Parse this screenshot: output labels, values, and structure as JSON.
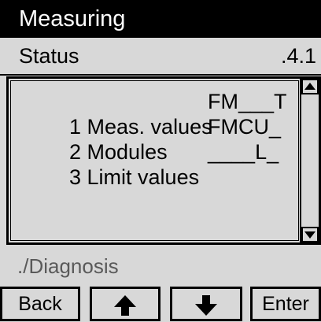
{
  "title": "Measuring",
  "status": {
    "label": "Status",
    "value": ".4.1"
  },
  "menu": {
    "items": [
      {
        "label": "1 Meas. values",
        "code": "FM___T"
      },
      {
        "label": "2 Modules",
        "code": "FMCU_"
      },
      {
        "label": "3 Limit values",
        "code": "____L_"
      }
    ]
  },
  "breadcrumb": "./Diagnosis",
  "softkeys": {
    "back": "Back",
    "up_icon": "arrow-up-icon",
    "down_icon": "arrow-down-icon",
    "enter": "Enter"
  }
}
